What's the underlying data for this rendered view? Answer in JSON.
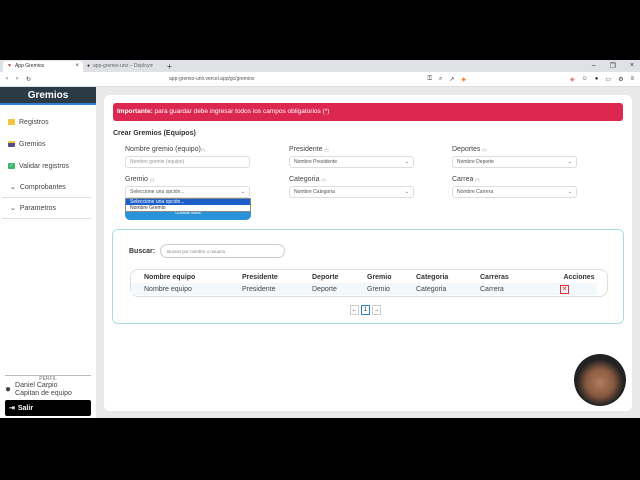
{
  "browser": {
    "tabs": [
      {
        "label": "App Gremios"
      },
      {
        "label": "app-gremio-unir – Deployments – V"
      }
    ],
    "url": "app-gremio-unir.vercel.app/gc/gremios"
  },
  "sidebar": {
    "title": "Gremios",
    "items": [
      {
        "label": "Registros"
      },
      {
        "label": "Gremios"
      },
      {
        "label": "Validar registros"
      }
    ],
    "groups": [
      {
        "label": "Comprobantes"
      },
      {
        "label": "Parametros"
      }
    ],
    "profile_label": "PERFIL",
    "user_name": "Daniel Carpio",
    "user_role": "Capitan de equipo",
    "logout": "Salir"
  },
  "banner": {
    "bold": "Importante:",
    "text": " para guardar debe ingresar todos los campos obligatorios (*)"
  },
  "form": {
    "title": "Crear Gremios (Equipos)",
    "req": "(*)",
    "nombre": {
      "label": "Nombre gremio (equipo)",
      "placeholder": "Nombre gremio (equipo)"
    },
    "presidente": {
      "label": "Presidente",
      "value": "Nombre Presidente"
    },
    "deportes": {
      "label": "Deportes",
      "value": "Nombre Deporte"
    },
    "gremio": {
      "label": "Gremio",
      "value": "Seleccione una opción...",
      "options": [
        "Seleccione una opción...",
        "Nombre Gremio"
      ]
    },
    "categoria": {
      "label": "Categoria",
      "value": "Nombre Categoria"
    },
    "carrera": {
      "label": "Carrea",
      "value": "Nombre Carrera"
    },
    "save_button": "Guardar datos"
  },
  "search": {
    "label": "Buscar:",
    "placeholder": "Buscar por nombre o usuario"
  },
  "table": {
    "headers": [
      "Nombre equipo",
      "Presidente",
      "Deporte",
      "Gremio",
      "Categoria",
      "Carreras",
      "Acciones"
    ],
    "rows": [
      [
        "Nombre equipo",
        "Presidente",
        "Deporte",
        "Gremio",
        "Categoria",
        "Carrera"
      ]
    ]
  },
  "pagination": {
    "prev": "←",
    "page": "1",
    "next": "→"
  }
}
